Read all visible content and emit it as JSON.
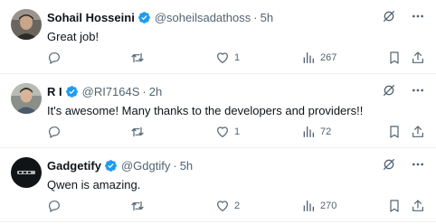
{
  "tweets": [
    {
      "name": "Sohail Hosseini",
      "handle": "@soheilsadathoss",
      "dot": "·",
      "time": "5h",
      "text": "Great job!",
      "replies": "",
      "retweets": "",
      "likes": "1",
      "views": "267",
      "avatar": "portrait-photo"
    },
    {
      "name": "R I",
      "handle": "@RI7164S",
      "dot": "·",
      "time": "2h",
      "text": "It's awesome!   Many thanks to the developers and providers!!",
      "replies": "",
      "retweets": "",
      "likes": "1",
      "views": "72",
      "avatar": "portrait-photo"
    },
    {
      "name": "Gadgetify",
      "handle": "@Gdgtify",
      "dot": "·",
      "time": "5h",
      "text": "Qwen is amazing.",
      "replies": "",
      "retweets": "",
      "likes": "2",
      "views": "270",
      "avatar": "dark-logo-with-text"
    }
  ],
  "colors": {
    "text": "#0f1419",
    "secondary": "#536471",
    "verified": "#1d9bf0",
    "divider": "#eff3f4"
  },
  "icons": [
    "verified-badge-icon",
    "grok-icon",
    "more-icon",
    "reply-icon",
    "retweet-icon",
    "like-icon",
    "views-icon",
    "bookmark-icon",
    "share-icon"
  ]
}
